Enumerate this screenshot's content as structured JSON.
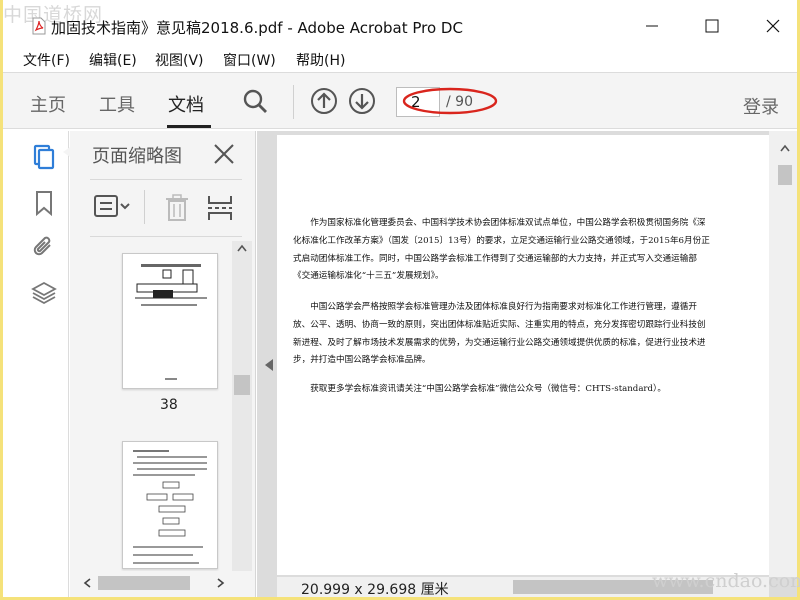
{
  "watermark_top": "中国道桥网",
  "watermark_bottom": "www.cndao.com",
  "window": {
    "title": "加固技术指南》意见稿2018.6.pdf - Adobe Acrobat Pro DC"
  },
  "menu": [
    {
      "label": "文件(F)"
    },
    {
      "label": "编辑(E)"
    },
    {
      "label": "视图(V)"
    },
    {
      "label": "窗口(W)"
    },
    {
      "label": "帮助(H)"
    }
  ],
  "toolbar": {
    "tabs": [
      {
        "label": "主页"
      },
      {
        "label": "工具"
      },
      {
        "label": "文档",
        "active": true
      }
    ],
    "page_current": "2",
    "page_total": "/ 90",
    "login": "登录"
  },
  "thumbnails": {
    "title": "页面缩略图",
    "page_label": "38"
  },
  "document": {
    "paragraphs": [
      "作为国家标准化管理委员会、中国科学技术协会团体标准双试点单位，中国公路学会积极贯彻国务院《深化标准化工作改革方案》（国发〔2015〕13号）的要求，立足交通运输行业公路交通领域，于2015年6月份正式启动团体标准工作。同时，中国公路学会标准工作得到了交通运输部的大力支持，并正式写入交通运输部《交通运输标准化“十三五”发展规划》。",
      "中国公路学会严格按照学会标准管理办法及团体标准良好行为指南要求对标准化工作进行管理，遵循开放、公平、透明、协商一致的原则，突出团体标准贴近实际、注重实用的特点，充分发挥密切跟踪行业科技创新进程、及时了解市场技术发展需求的优势，为交通运输行业公路交通领域提供优质的标准，促进行业技术进步，并打造中国公路学会标准品牌。",
      "获取更多学会标准资讯请关注“中国公路学会标准”微信公众号（微信号：CHTS-standard）。"
    ],
    "page_size": "20.999 x 29.698 厘米"
  },
  "colors": {
    "annotation_red": "#d9251d",
    "accent_blue": "#2f7ed8"
  }
}
